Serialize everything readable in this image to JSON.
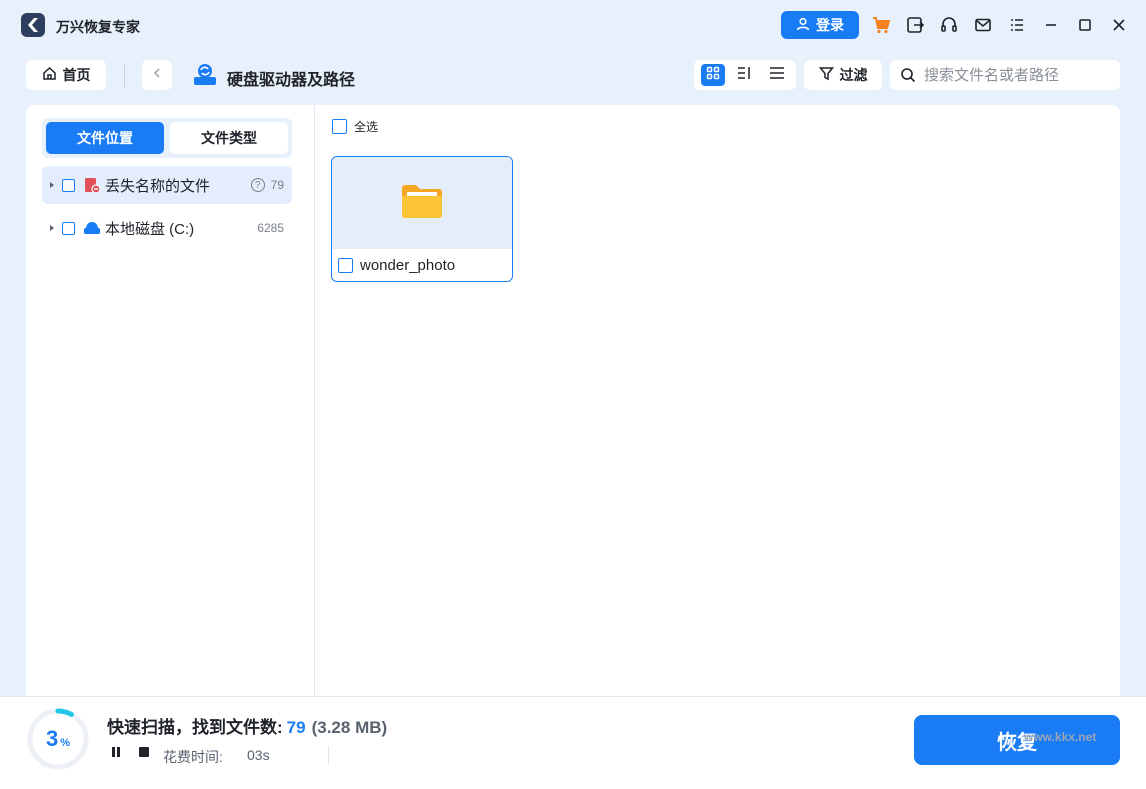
{
  "app": {
    "title": "万兴恢复专家"
  },
  "titlebar": {
    "login_label": "登录"
  },
  "toolbar": {
    "home_label": "首页",
    "path_title": "硬盘驱动器及路径",
    "filter_label": "过滤",
    "search_placeholder": "搜索文件名或者路径"
  },
  "sidebar": {
    "tabs": [
      {
        "label": "文件位置",
        "active": true
      },
      {
        "label": "文件类型",
        "active": false
      }
    ],
    "items": [
      {
        "label": "丢失名称的文件",
        "count": "79",
        "icon": "lost-file-icon",
        "selected": true
      },
      {
        "label": "本地磁盘 (C:)",
        "count": "6285",
        "icon": "disk-icon",
        "selected": false
      }
    ]
  },
  "main": {
    "select_all_label": "全选",
    "files": [
      {
        "name": "wonder_photo",
        "icon": "folder-icon"
      }
    ]
  },
  "status": {
    "progress_percent": "3",
    "progress_unit": "%",
    "progress_fraction": 0.03,
    "scan_label": "快速扫描，找到文件数:",
    "file_count": "79",
    "size": "(3.28 MB)",
    "time_label": "花费时间:",
    "time_value": "03s",
    "recover_label": "恢复"
  },
  "watermark": "www.kkx.net",
  "colors": {
    "accent": "#1a7cf5",
    "background": "#e8f0fb",
    "cart": "#f5821f"
  }
}
